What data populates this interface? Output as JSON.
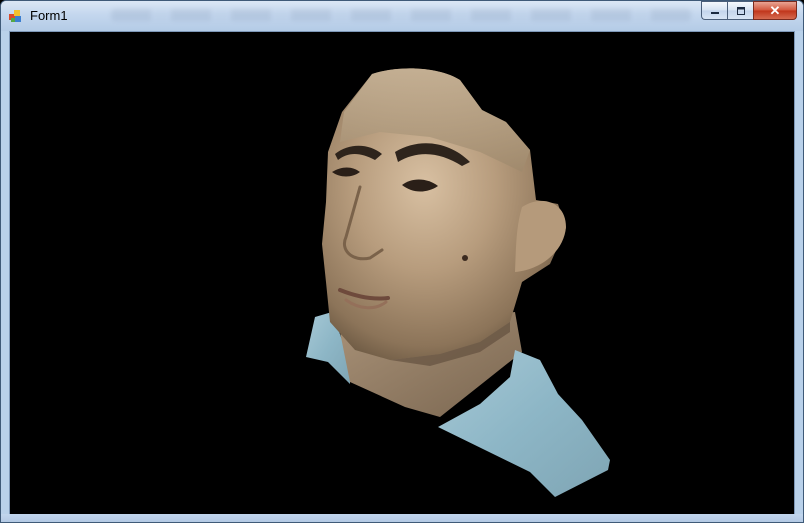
{
  "window": {
    "title": "Form1",
    "icon": "form-app-icon",
    "buttons": {
      "minimize_icon": "minimize-icon",
      "maximize_icon": "maximize-icon",
      "close_label": "✕"
    }
  },
  "viewport": {
    "background": "#000000",
    "content": "3d-face-scan-model"
  },
  "colors": {
    "titlebar": "#c4d7ee",
    "close": "#c7432a",
    "shirt": "#8fb8c9",
    "skin": "#b89b7c"
  }
}
